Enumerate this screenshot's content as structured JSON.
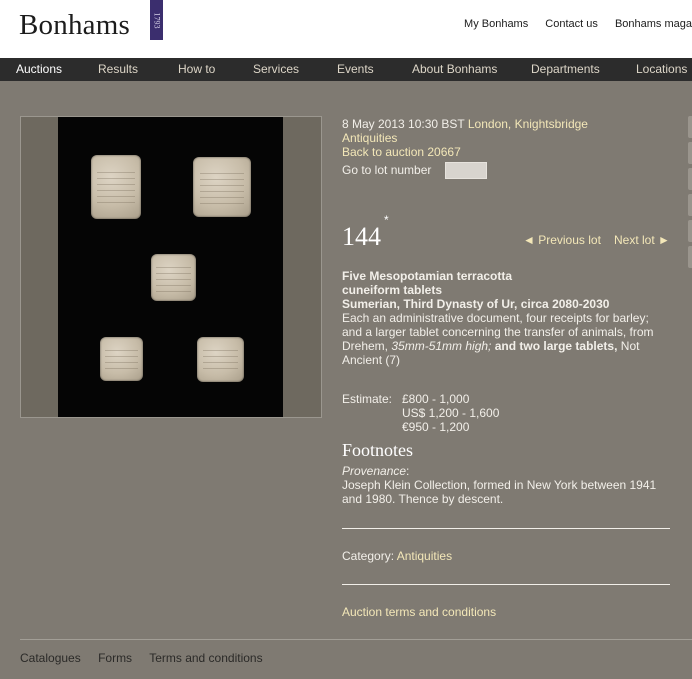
{
  "brand": {
    "name": "Bonhams",
    "year": "1793"
  },
  "top_links": [
    "My Bonhams",
    "Contact us",
    "Bonhams maga"
  ],
  "nav": {
    "items": [
      "Auctions",
      "Results",
      "How to",
      "Services",
      "Events",
      "About Bonhams",
      "Departments",
      "Locations"
    ],
    "active": "Auctions"
  },
  "lot": {
    "datetime": "8 May 2013 10:30 BST",
    "location": "London, Knightsbridge",
    "department": "Antiquities",
    "back_link": "Back to auction 20667",
    "goto_label": "Go to lot number",
    "number": "144",
    "star": "*",
    "prev_label": "◄ Previous lot",
    "next_label": "Next lot ►",
    "title_line1": "Five Mesopotamian terracotta",
    "title_line2": "cuneiform tablets",
    "subtitle": "Sumerian, Third Dynasty of Ur, circa 2080-2030",
    "desc_part1": "Each an administrative document, four receipts for barley; and a larger tablet concerning the transfer of animals, from Drehem,",
    "desc_italic": "35mm-51mm high;",
    "desc_bold": "and two large tablets,",
    "desc_part2": "Not Ancient (7)"
  },
  "estimate": {
    "label": "Estimate:",
    "gbp": "£800 - 1,000",
    "usd": "US$ 1,200 - 1,600",
    "eur": "€950 - 1,200"
  },
  "footnotes": {
    "title": "Footnotes",
    "provenance_label": "Provenance",
    "provenance_text": "Joseph Klein Collection, formed in New York between 1941 and 1980. Thence by descent."
  },
  "category": {
    "label": "Category:",
    "value": "Antiquities"
  },
  "terms_link": "Auction terms and conditions",
  "footer": {
    "links": [
      "Catalogues",
      "Forms",
      "Terms and conditions"
    ]
  },
  "colors": {
    "page_bg": "#7f7a72",
    "nav_bg": "#2c2c2c",
    "link": "#f3e7b8",
    "brand_purple": "#3b2e6e"
  }
}
